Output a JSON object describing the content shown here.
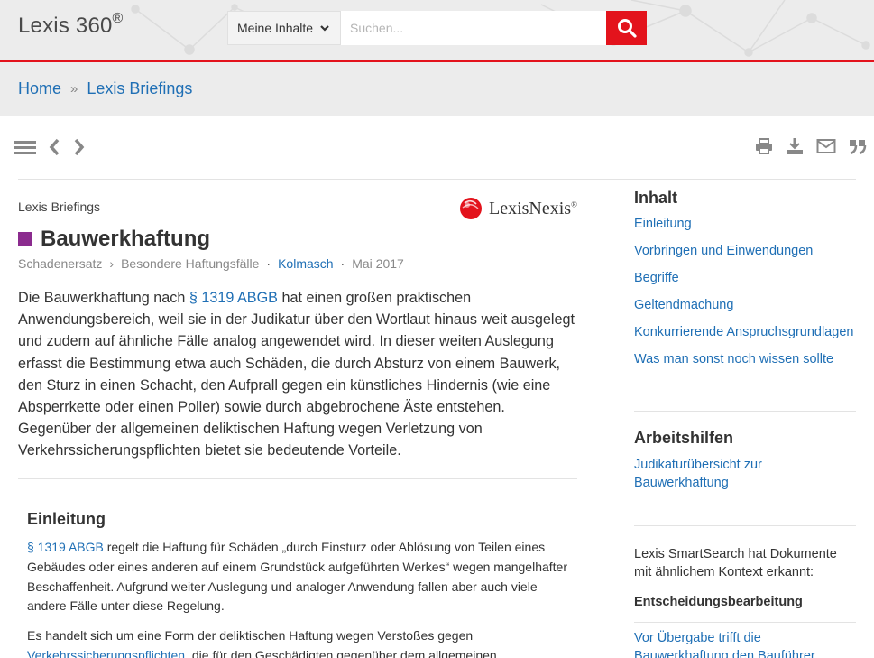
{
  "header": {
    "logo": "Lexis 360",
    "logo_mark": "®",
    "scope": "Meine Inhalte",
    "search_placeholder": "Suchen..."
  },
  "breadcrumb": {
    "home": "Home",
    "separator": "»",
    "current": "Lexis Briefings"
  },
  "article": {
    "kicker": "Lexis Briefings",
    "publisher_logo": "LexisNexis",
    "publisher_mark": "®",
    "title": "Bauwerkhaftung",
    "meta": {
      "category": "Schadenersatz",
      "separator": "›",
      "subcategory": "Besondere Haftungsfälle",
      "dot": "·",
      "author": "Kolmasch",
      "date": "Mai 2017"
    },
    "lead": {
      "before": "Die Bauwerkhaftung nach ",
      "link": "§ 1319 ABGB",
      "after": " hat einen großen praktischen Anwendungsbereich, weil sie in der Judikatur über den Wortlaut hinaus weit ausgelegt und zudem auf ähnliche Fälle analog angewendet wird. In dieser weiten Auslegung erfasst die Bestimmung etwa auch Schäden, die durch Absturz von einem Bauwerk, den Sturz in einen Schacht, den Aufprall gegen ein künstliches Hindernis (wie eine Absperrkette oder einen Poller) sowie durch abgebrochene Äste entstehen. Gegenüber der allgemeinen deliktischen Haftung wegen Verletzung von Verkehrssicherungspflichten bietet sie bedeutende Vorteile."
    },
    "section": {
      "title": "Einleitung",
      "p1_link": "§ 1319 ABGB",
      "p1_text": " regelt die Haftung für Schäden „durch Einsturz oder Ablösung von Teilen eines Gebäudes oder eines anderen auf einem Grundstück aufgeführten Werkes“ wegen mangelhafter Beschaffenheit. Aufgrund weiter Auslegung und analoger Anwendung fallen aber auch viele andere Fälle unter diese Regelung.",
      "p2_before": "Es handelt sich um eine Form der deliktischen Haftung wegen Verstoßes gegen ",
      "p2_link": "Verkehrssicherungspflichten",
      "p2_after": ", die für den Geschädigten gegenüber dem allgemeinen"
    }
  },
  "sidebar": {
    "toc_title": "Inhalt",
    "toc": [
      "Einleitung",
      "Vorbringen und Einwendungen",
      "Begriffe",
      "Geltendmachung",
      "Konkurrierende Anspruchsgrundlagen",
      "Was man sonst noch wissen sollte"
    ],
    "tools_title": "Arbeitshilfen",
    "tools_link": "Judikaturübersicht zur Bauwerkhaftung",
    "smart_text": "Lexis SmartSearch hat Dokumente mit ähnlichem Kontext erkannt:",
    "smart_category": "Entscheidungsbearbeitung",
    "smart_link": "Vor Übergabe trifft die Bauwerkhaftung den Bauführer"
  },
  "colors": {
    "brand_red": "#e3131c",
    "link_blue": "#1f6fb5",
    "title_marker": "#8b2b8e"
  },
  "icons": [
    "menu-icon",
    "chevron-left-icon",
    "chevron-right-icon",
    "print-icon",
    "download-icon",
    "mail-icon",
    "quote-icon",
    "search-icon",
    "chevron-down-icon",
    "lexisnexis-logo"
  ]
}
